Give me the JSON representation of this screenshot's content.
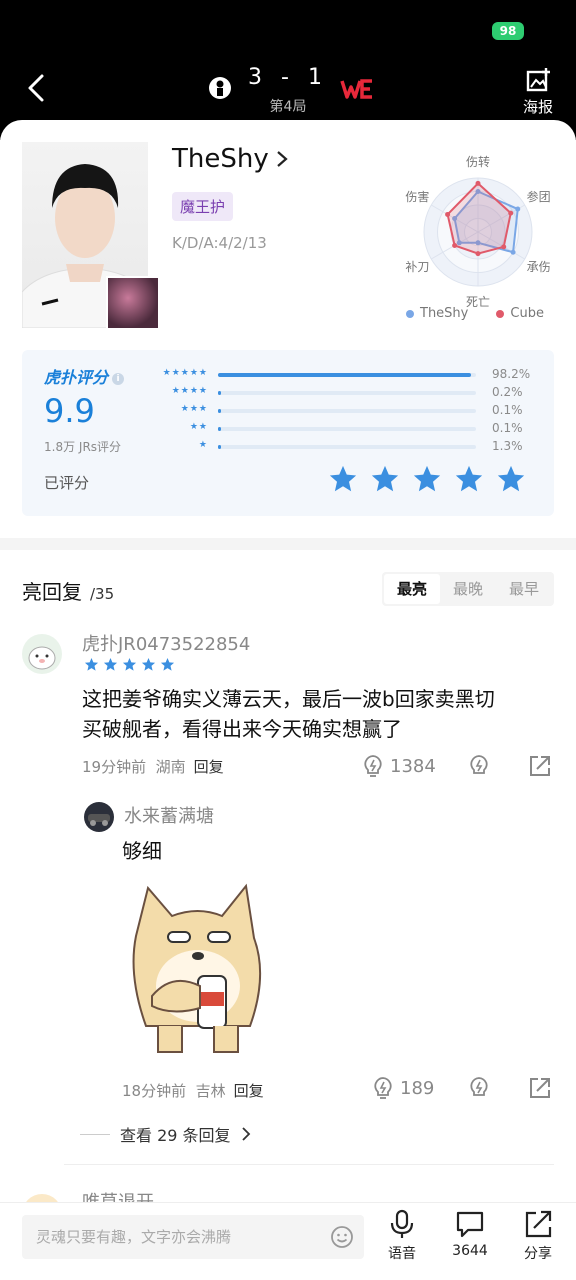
{
  "status": {
    "battery": "98"
  },
  "header": {
    "score": "3 - 1",
    "game_no": "第4局",
    "poster_label": "海报",
    "left_team_icon": "ig-logo-icon",
    "right_team_icon": "we-logo-icon"
  },
  "player": {
    "name": "TheShy",
    "nickname": "魔王护",
    "kda": "K/D/A:4/2/13"
  },
  "radar": {
    "axes": [
      "伤转",
      "参团",
      "承伤",
      "死亡",
      "补刀",
      "伤害"
    ],
    "series": [
      {
        "name": "TheShy",
        "color": "#7aa7e6",
        "values": [
          0.75,
          0.85,
          0.75,
          0.2,
          0.4,
          0.5
        ]
      },
      {
        "name": "Cube",
        "color": "#e05a6a",
        "values": [
          0.9,
          0.7,
          0.55,
          0.4,
          0.5,
          0.65
        ]
      }
    ]
  },
  "rating": {
    "logo": "虎扑评分",
    "score": "9.9",
    "count": "1.8万 JRs评分",
    "rated_label": "已评分",
    "my_stars": 5,
    "distribution": [
      {
        "stars": 5,
        "pct_label": "98.2%",
        "pct": 98.2
      },
      {
        "stars": 4,
        "pct_label": "0.2%",
        "pct": 0.2
      },
      {
        "stars": 3,
        "pct_label": "0.1%",
        "pct": 0.1
      },
      {
        "stars": 2,
        "pct_label": "0.1%",
        "pct": 0.1
      },
      {
        "stars": 1,
        "pct_label": "1.3%",
        "pct": 1.3
      }
    ]
  },
  "replies": {
    "title": "亮回复",
    "count": "/35",
    "tabs": [
      "最亮",
      "最晚",
      "最早"
    ],
    "active_tab": 0
  },
  "comment1": {
    "user": "虎扑JR0473522854",
    "text_line1": "这把姜爷确实义薄云天，最后一波b回家卖黑切",
    "text_line2": "买破舰者，看得出来今天确实想赢了",
    "time": "19分钟前",
    "location": "湖南",
    "reply_label": "回复",
    "likes": "1384"
  },
  "comment2": {
    "user": "水来蓄满塘",
    "text": "够细",
    "time": "18分钟前",
    "location": "吉林",
    "reply_label": "回复",
    "likes": "189"
  },
  "view_more": "查看 29 条回复",
  "next_user": "唯草退开",
  "bottom": {
    "input_placeholder": "灵魂只要有趣，文字亦会沸腾",
    "voice_label": "语音",
    "comment_count": "3644",
    "share_label": "分享"
  }
}
